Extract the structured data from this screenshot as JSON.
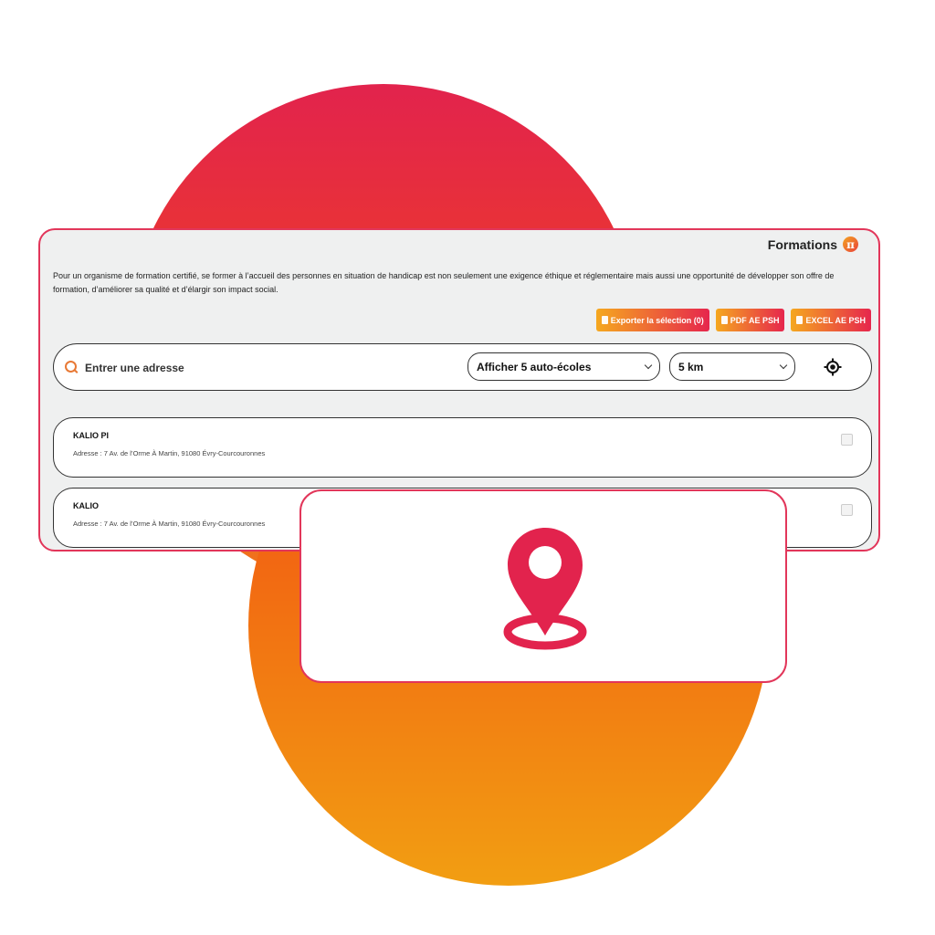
{
  "brand": {
    "name": "Formations",
    "logo_glyph": "π",
    "accent": "#e2234d",
    "gradient_start": "#f5a81f",
    "gradient_end": "#e6264d"
  },
  "intro": {
    "text": "Pour un organisme de formation certifié, se former à l’accueil des personnes en situation de handicap est non seulement une exigence éthique et réglementaire mais aussi une opportunité de développer son offre de formation, d’améliorer sa qualité et d’élargir son impact social."
  },
  "actions": {
    "export_label": "Exporter la sélection (0)",
    "pdf_label": "PDF AE PSH",
    "excel_label": "EXCEL AE PSH",
    "icon": "file-icon"
  },
  "search": {
    "placeholder": "Entrer une adresse",
    "value": "",
    "icon": "search-icon",
    "count_select": {
      "value": "Afficher 5 auto-écoles"
    },
    "radius_select": {
      "value": "5 km"
    },
    "locate_icon": "crosshair-icon"
  },
  "results": [
    {
      "name": "KALIO PI",
      "address": "Adresse : 7 Av. de l’Orme À Martin, 91080 Évry-Courcouronnes",
      "checked": false
    },
    {
      "name": "KALIO",
      "address": "Adresse : 7 Av. de l’Orme À Martin, 91080 Évry-Courcouronnes",
      "checked": false
    }
  ],
  "overlay": {
    "icon": "map-pin-icon",
    "color": "#e2234d"
  }
}
